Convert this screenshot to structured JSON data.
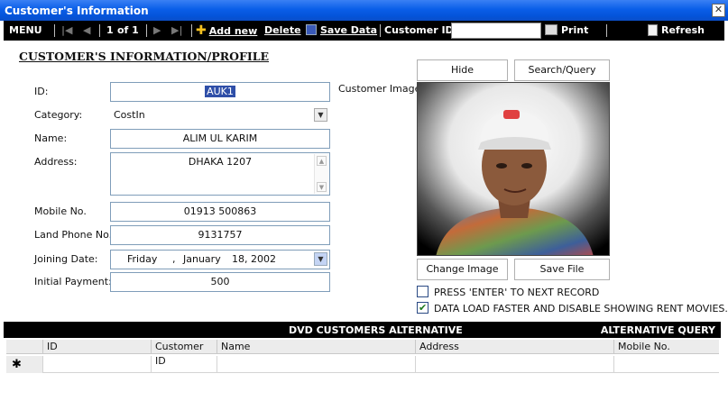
{
  "window": {
    "title": "Customer's Information",
    "close_glyph": "✕"
  },
  "toolbar": {
    "menu": "MENU",
    "record_current": "1",
    "record_of": "of 1",
    "add_new": "Add new",
    "delete": "Delete",
    "save_data": "Save Data",
    "customer_id_label": "Customer ID:",
    "customer_id_value": "",
    "print": "Print",
    "refresh": "Refresh"
  },
  "form": {
    "heading": "CUSTOMER'S INFORMATION/PROFILE",
    "id_label": "ID:",
    "id_value": "AUK1",
    "category_label": "Category:",
    "category_value": "CostIn",
    "name_label": "Name:",
    "name_value": "ALIM UL KARIM",
    "address_label": "Address:",
    "address_value": "DHAKA 1207",
    "mobile_label": "Mobile No.",
    "mobile_value": "01913 500863",
    "land_label": "Land Phone No.",
    "land_value": "9131757",
    "joining_label": "Joining Date:",
    "joining_day": "Friday",
    "joining_sep": ",",
    "joining_month": "January",
    "joining_date": "18, 2002",
    "payment_label": "Initial Payment:",
    "payment_value": "500"
  },
  "image_panel": {
    "hide": "Hide",
    "search": "Search/Query",
    "label": "Customer Image:",
    "change": "Change Image",
    "save": "Save File"
  },
  "options": [
    {
      "label": "PRESS 'ENTER' TO NEXT RECORD",
      "checked": false
    },
    {
      "label": "DATA LOAD FASTER AND DISABLE SHOWING RENT MOVIES.",
      "checked": true
    }
  ],
  "grid": {
    "title": "DVD CUSTOMERS ALTERNATIVE",
    "alt_query": "ALTERNATIVE QUERY",
    "columns": [
      "ID",
      "Customer ID",
      "Name",
      "Address",
      "Mobile No."
    ],
    "new_row_marker": "✱"
  },
  "colors": {
    "titlebar": "#0a5ee8",
    "toolbar": "#000000",
    "selection": "#2f4fa8",
    "field_border": "#7f9db9"
  }
}
